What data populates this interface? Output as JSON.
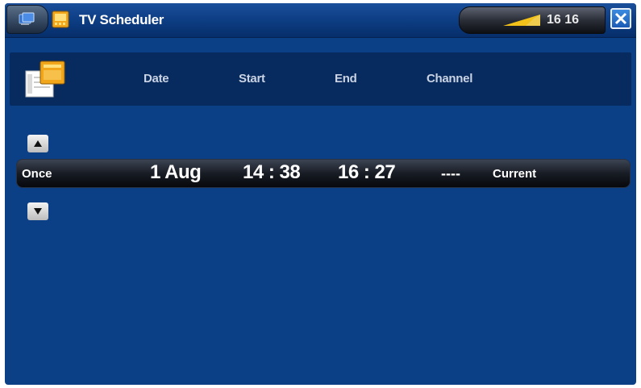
{
  "titlebar": {
    "app_title": "TV Scheduler",
    "clock": "16 16"
  },
  "icons": {
    "home": "home-icon",
    "app": "tv-scheduler-icon",
    "signal": "signal-strength-icon",
    "close": "close-icon",
    "list": "schedule-list-icon",
    "up": "arrow-up-icon",
    "down": "arrow-down-icon"
  },
  "columns": {
    "date": "Date",
    "start": "Start",
    "end": "End",
    "channel": "Channel"
  },
  "rows": [
    {
      "repeat": "Once",
      "date": "1 Aug",
      "start": "14 : 38",
      "end": "16 : 27",
      "channel": "----",
      "source": "Current"
    }
  ],
  "colors": {
    "background": "#0b3f86",
    "header_bar": "#082b5f",
    "accent_orange": "#f2a71b"
  }
}
